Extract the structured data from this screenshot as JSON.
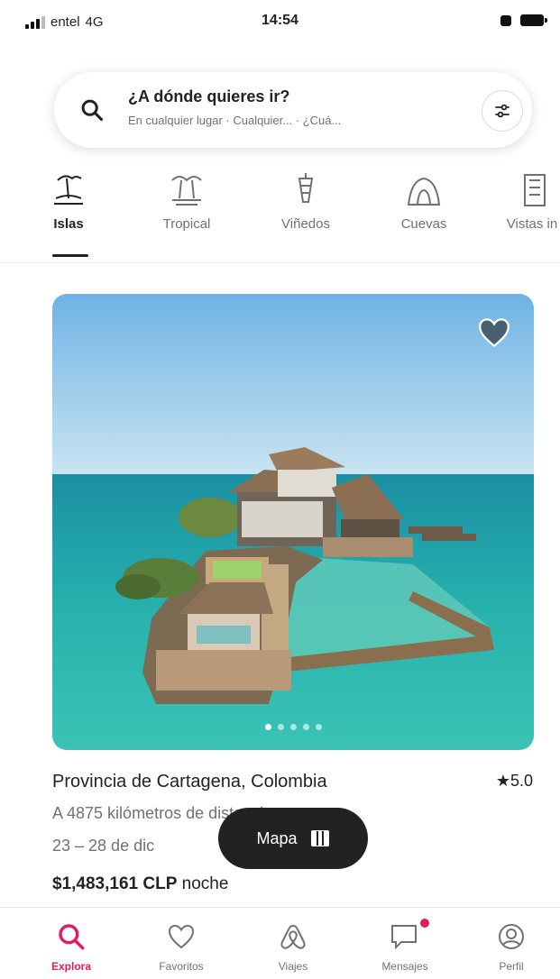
{
  "status_bar": {
    "carrier": "entel",
    "network": "4G",
    "time": "14:54"
  },
  "search": {
    "title": "¿A dónde quieres ir?",
    "subtitle": "En cualquier lugar · Cualquier... · ¿Cuá..."
  },
  "categories": [
    {
      "label": "Islas",
      "icon": "island-icon"
    },
    {
      "label": "Tropical",
      "icon": "palm-trees-icon"
    },
    {
      "label": "Viñedos",
      "icon": "grapes-icon"
    },
    {
      "label": "Cuevas",
      "icon": "cave-icon"
    },
    {
      "label": "Vistas in",
      "icon": "building-icon"
    }
  ],
  "listing": {
    "title": "Provincia de Cartagena, Colombia",
    "rating": "5.0",
    "distance": "A 4875 kilómetros de distancia",
    "dates": "23 – 28 de dic",
    "price": "$1,483,161 CLP",
    "price_suffix": "noche",
    "photo_count": 5,
    "active_photo": 1
  },
  "map_button": {
    "label": "Mapa"
  },
  "bottom_nav": [
    {
      "label": "Explora",
      "icon": "search-icon"
    },
    {
      "label": "Favoritos",
      "icon": "heart-icon"
    },
    {
      "label": "Viajes",
      "icon": "airbnb-logo-icon"
    },
    {
      "label": "Mensajes",
      "icon": "message-icon"
    },
    {
      "label": "Perfil",
      "icon": "profile-icon"
    }
  ],
  "colors": {
    "accent": "#e31c5f",
    "text": "#222222",
    "muted": "#717171"
  }
}
